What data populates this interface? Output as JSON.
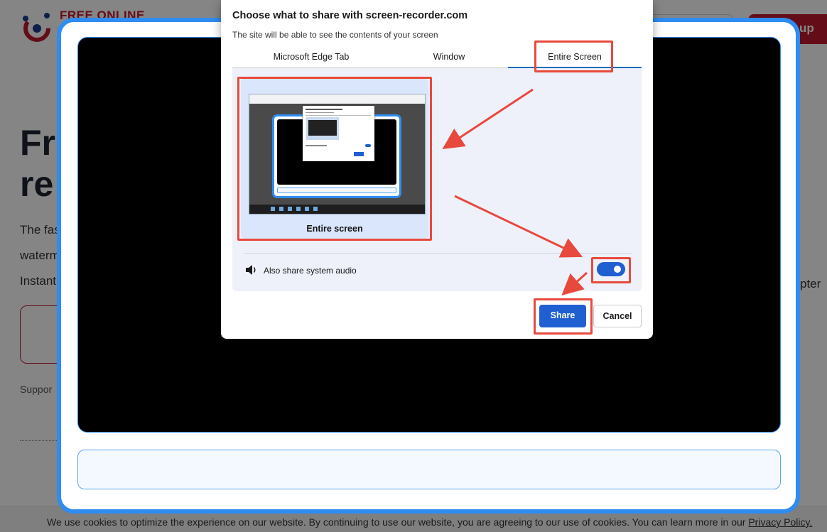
{
  "background": {
    "logo_text": "FREE ONLINE",
    "signup_label": "up",
    "hero_lines": [
      "Fr",
      "re"
    ],
    "paragraph_lines": [
      "The fas",
      "waterm",
      "Instant"
    ],
    "support_text": "Suppor",
    "side_text": "pter",
    "cookie_text": "We use cookies to optimize the experience on our website. By continuing to use our website, you are agreeing to our use of cookies. You can learn more in our ",
    "cookie_link": "Privacy Policy."
  },
  "dialog": {
    "title": "Choose what to share with screen-recorder.com",
    "subtitle": "The site will be able to see the contents of your screen",
    "tabs": [
      {
        "label": "Microsoft Edge Tab",
        "selected": false
      },
      {
        "label": "Window",
        "selected": false
      },
      {
        "label": "Entire Screen",
        "selected": true
      }
    ],
    "source": {
      "label": "Entire screen"
    },
    "audio": {
      "label": "Also share system audio",
      "enabled": true
    },
    "share_label": "Share",
    "cancel_label": "Cancel"
  },
  "colors": {
    "accent": "#1f5fd1",
    "recorder_border": "#2f8cf0",
    "annotation": "#e8493d",
    "brand": "#c0182e"
  },
  "icons": {
    "speaker": "speaker-icon",
    "logo": "brand-logo-icon"
  }
}
